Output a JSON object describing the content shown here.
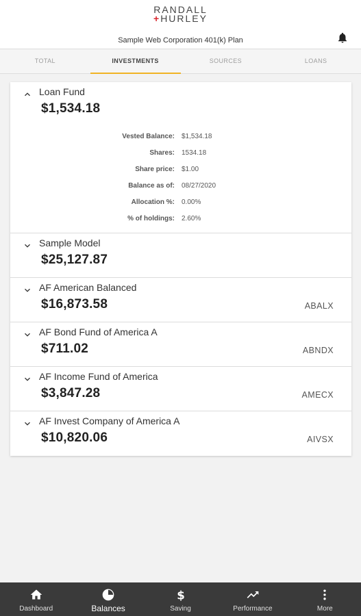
{
  "header": {
    "logo_line1": "RANDALL",
    "logo_line2": "HURLEY",
    "plan_title": "Sample Web Corporation 401(k) Plan",
    "notification_icon": "bell-icon"
  },
  "tabs": [
    {
      "label": "TOTAL",
      "active": false
    },
    {
      "label": "INVESTMENTS",
      "active": true
    },
    {
      "label": "SOURCES",
      "active": false
    },
    {
      "label": "LOANS",
      "active": false
    }
  ],
  "funds": [
    {
      "name": "Loan Fund",
      "balance": "$1,534.18",
      "ticker": "",
      "expanded": true,
      "details": [
        {
          "label": "Vested Balance:",
          "value": "$1,534.18"
        },
        {
          "label": "Shares:",
          "value": "1534.18"
        },
        {
          "label": "Share price:",
          "value": "$1.00"
        },
        {
          "label": "Balance as of:",
          "value": "08/27/2020"
        },
        {
          "label": "Allocation %:",
          "value": "0.00%"
        },
        {
          "label": "% of holdings:",
          "value": "2.60%"
        }
      ]
    },
    {
      "name": "Sample Model",
      "balance": "$25,127.87",
      "ticker": "",
      "expanded": false
    },
    {
      "name": "AF American Balanced",
      "balance": "$16,873.58",
      "ticker": "ABALX",
      "expanded": false
    },
    {
      "name": "AF Bond Fund of America A",
      "balance": "$711.02",
      "ticker": "ABNDX",
      "expanded": false
    },
    {
      "name": "AF Income Fund of America",
      "balance": "$3,847.28",
      "ticker": "AMECX",
      "expanded": false
    },
    {
      "name": "AF Invest Company of America A",
      "balance": "$10,820.06",
      "ticker": "AIVSX",
      "expanded": false
    }
  ],
  "bottom_nav": [
    {
      "label": "Dashboard",
      "icon": "home-icon",
      "active": false
    },
    {
      "label": "Balances",
      "icon": "pie-chart-icon",
      "active": true
    },
    {
      "label": "Saving",
      "icon": "dollar-icon",
      "active": false
    },
    {
      "label": "Performance",
      "icon": "trending-up-icon",
      "active": false
    },
    {
      "label": "More",
      "icon": "more-vertical-icon",
      "active": false
    }
  ],
  "colors": {
    "accent": "#f0b323",
    "logo_red": "#d9272e",
    "nav_background": "#3a3a3a"
  }
}
